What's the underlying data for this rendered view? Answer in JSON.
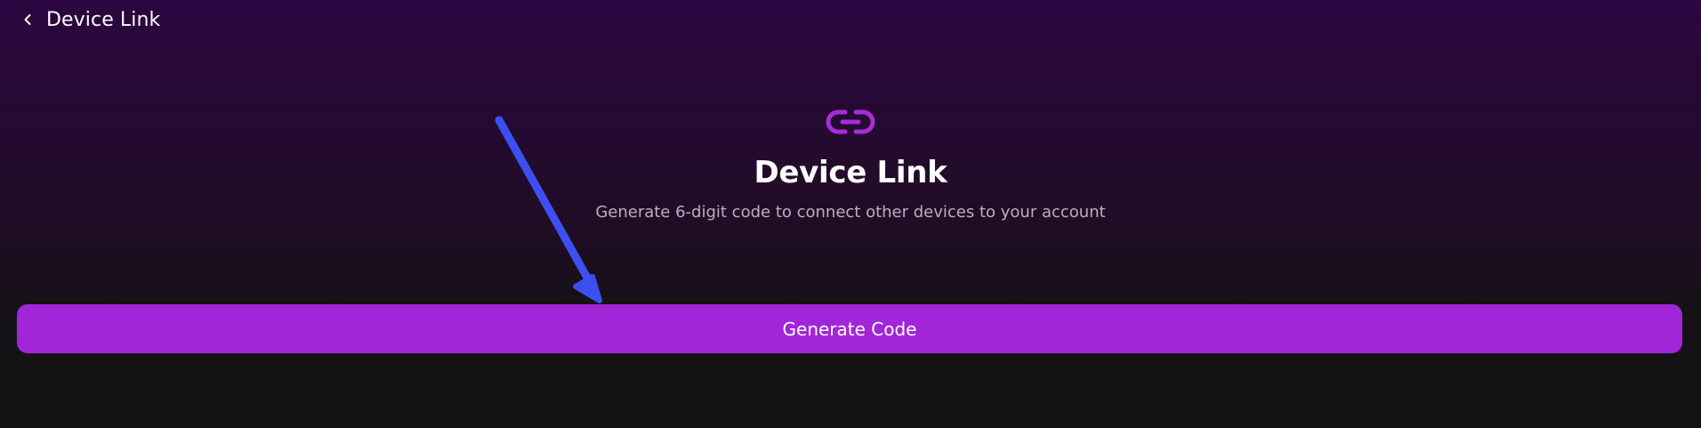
{
  "header": {
    "back_icon": "chevron-left-icon",
    "title": "Device Link"
  },
  "hero": {
    "icon": "link-icon",
    "title": "Device Link",
    "subtitle": "Generate 6-digit code to connect other devices to your account"
  },
  "actions": {
    "generate_label": "Generate Code"
  },
  "colors": {
    "accent": "#a026d8",
    "icon": "#a72dd9",
    "annotation_arrow": "#3d4ff0",
    "background_top": "#2c0640",
    "background_bottom": "#131313"
  }
}
